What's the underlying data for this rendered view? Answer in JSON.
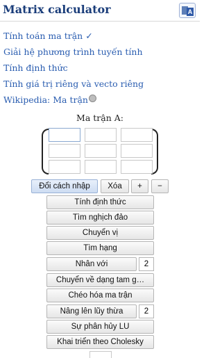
{
  "header": {
    "title": "Matrix calculator",
    "translate_icon_label": "A"
  },
  "links": [
    "Tính toán ma trận ✓",
    "Giải hệ phương trình tuyến tính",
    "Tính định thức",
    "Tính giá trị riêng và vecto riêng",
    "Wikipedia: Ma trận"
  ],
  "matrix": {
    "label": "Ma trận A:",
    "cells": [
      "",
      "",
      "",
      "",
      "",
      "",
      "",
      "",
      ""
    ]
  },
  "controls": {
    "change_input": "Đổi cách nhập",
    "clear": "Xóa",
    "plus": "+",
    "minus": "−"
  },
  "operations": {
    "determinant": "Tính định thức",
    "inverse": "Tìm nghịch đảo",
    "transpose": "Chuyển vị",
    "rank": "Tìm hạng",
    "multiply": "Nhân với",
    "multiply_value": "2",
    "triangular": "Chuyển về dạng tam g…",
    "diagonalize": "Chéo hóa ma trận",
    "power": "Nâng lên lũy thừa",
    "power_value": "2",
    "lu": "Sự phân hủy LU",
    "cholesky": "Khai triển theo Cholesky"
  }
}
